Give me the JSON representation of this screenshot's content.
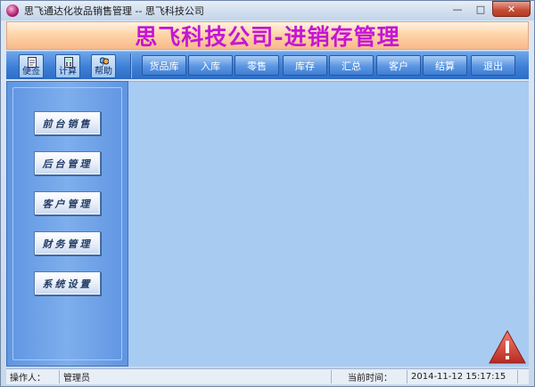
{
  "window": {
    "title": "思飞通达化妆品销售管理 -- 思飞科技公司",
    "minimize_glyph": "—",
    "maximize_glyph": "□",
    "close_glyph": "✕"
  },
  "banner": {
    "title": "思飞科技公司-进销存管理"
  },
  "toolbar": {
    "tools": [
      {
        "label": "便签",
        "icon": "note-icon"
      },
      {
        "label": "计算",
        "icon": "calculator-icon"
      },
      {
        "label": "帮助",
        "icon": "help-icon"
      }
    ],
    "menu": [
      "货品库",
      "入库",
      "零售",
      "库存",
      "汇总",
      "客户",
      "结算",
      "退出"
    ]
  },
  "sidebar": {
    "items": [
      "前台销售",
      "后台管理",
      "客户管理",
      "财务管理",
      "系统设置"
    ]
  },
  "statusbar": {
    "operator_label": "操作人：",
    "operator_value": "管理员",
    "time_label": "当前时间：",
    "time_value": "2014-11-12 15:17:15"
  },
  "colors": {
    "banner_text": "#c416d6",
    "toolbar_bg": "#3e7fd6",
    "main_bg": "#a8cbf2",
    "warning": "#d9473a"
  }
}
